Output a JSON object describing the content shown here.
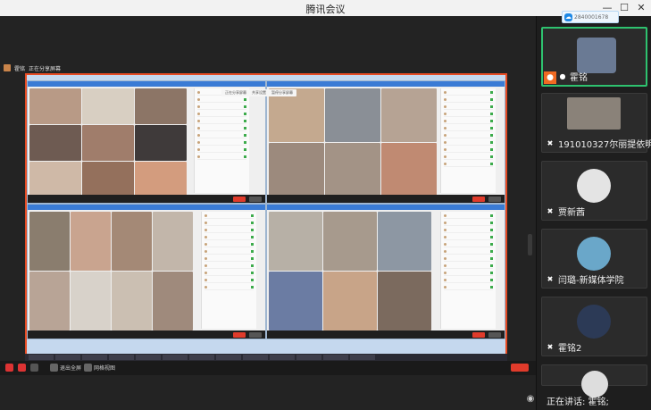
{
  "window": {
    "title": "腾讯会议"
  },
  "badge": {
    "text": "2840001678"
  },
  "share": {
    "presenter": "霍铭",
    "status_text": "正在分享屏幕"
  },
  "shared_bar": {
    "items": [
      "正在分享屏幕",
      "共享设置",
      "暂停分享屏幕"
    ]
  },
  "toolbar": {
    "leave_label": "退出全屏",
    "layout_label": "网格视图"
  },
  "participants": [
    {
      "name": "霍铭",
      "active": true
    },
    {
      "name": "191010327尔丽提依明",
      "active": false
    },
    {
      "name": "贾新茜",
      "active": false
    },
    {
      "name": "闫璐-新媒体学院",
      "active": false
    },
    {
      "name": "霍铭2",
      "active": false
    }
  ],
  "speaking": {
    "text": "正在讲话: 霍铭;"
  },
  "colors": {
    "accent": "#2ec26f",
    "end": "#e03b2b",
    "brand": "#1e88e5",
    "share_border": "#e74c24"
  }
}
